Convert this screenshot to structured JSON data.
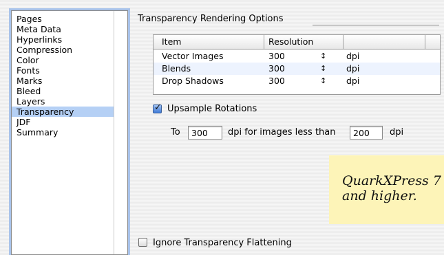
{
  "sidebar": {
    "items": [
      {
        "label": "Pages"
      },
      {
        "label": "Meta Data"
      },
      {
        "label": "Hyperlinks"
      },
      {
        "label": "Compression"
      },
      {
        "label": "Color"
      },
      {
        "label": "Fonts"
      },
      {
        "label": "Marks"
      },
      {
        "label": "Bleed"
      },
      {
        "label": "Layers"
      },
      {
        "label": "Transparency",
        "selected": true
      },
      {
        "label": "JDF"
      },
      {
        "label": "Summary"
      }
    ]
  },
  "section": {
    "title": "Transparency Rendering Options"
  },
  "table": {
    "columns": [
      "Item",
      "Resolution"
    ],
    "rows": [
      {
        "item": "Vector Images",
        "resolution": "300",
        "unit": "dpi"
      },
      {
        "item": "Blends",
        "resolution": "300",
        "unit": "dpi"
      },
      {
        "item": "Drop Shadows",
        "resolution": "300",
        "unit": "dpi"
      }
    ],
    "stepper_glyph": "↕"
  },
  "upsample": {
    "label": "Upsample Rotations",
    "checked": true,
    "to_label": "To",
    "to_value": "300",
    "mid_label": "dpi for images less than",
    "threshold_value": "200",
    "unit": "dpi"
  },
  "ignore_flattening": {
    "label": "Ignore Transparency Flattening",
    "checked": false
  },
  "note": {
    "line1": "QuarkXPress 7",
    "line2": "and higher."
  },
  "colors": {
    "selection": "#b5d0f5",
    "focus_ring": "#a9c3ea",
    "note_bg": "#fdf4b8",
    "checkbox_checked": "#3f7ad6"
  }
}
